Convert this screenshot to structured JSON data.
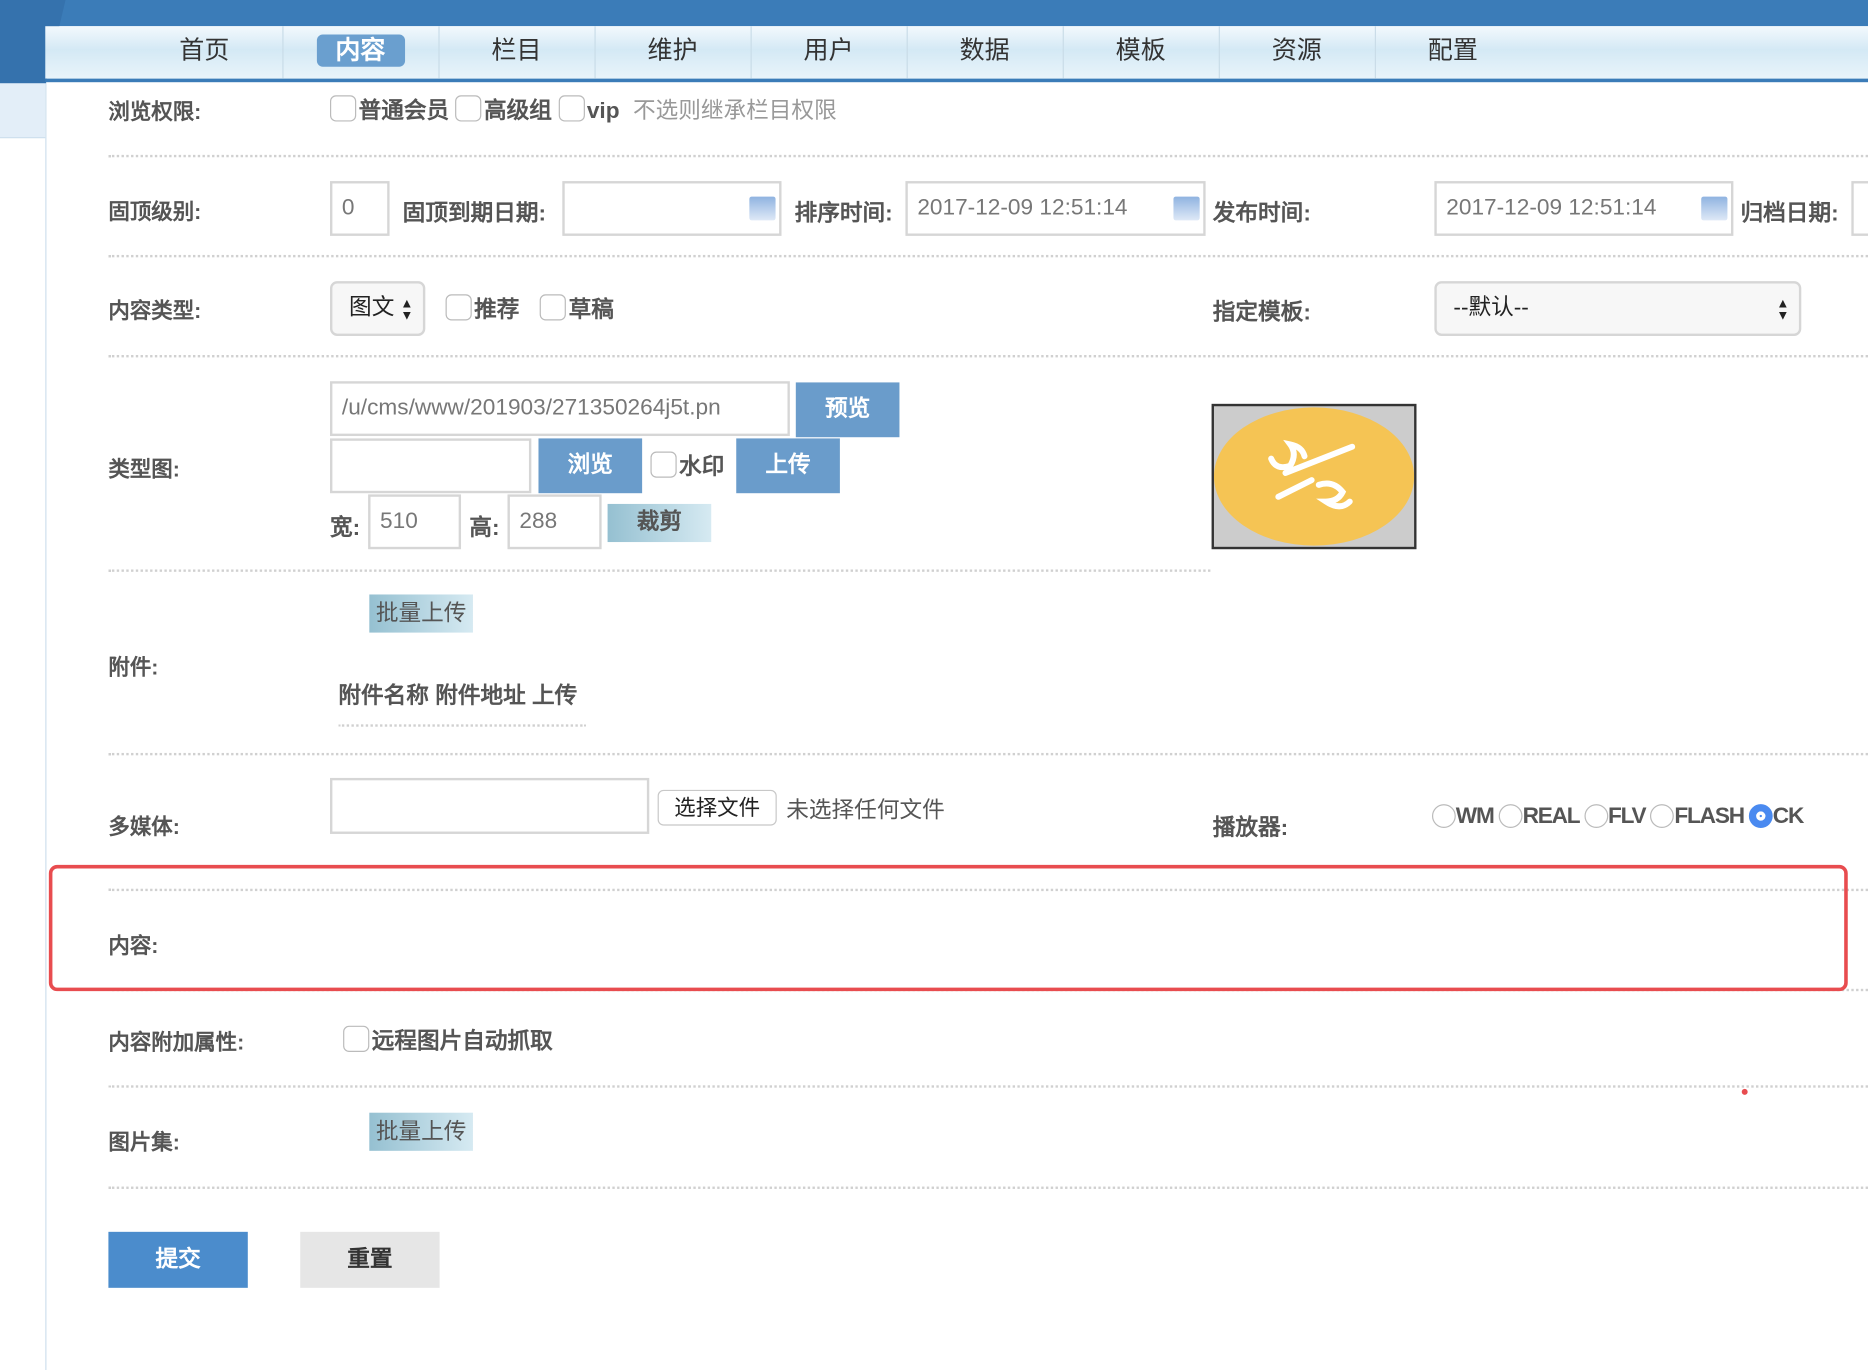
{
  "nav": {
    "items": [
      "首页",
      "内容",
      "栏目",
      "维护",
      "用户",
      "数据",
      "模板",
      "资源",
      "配置"
    ],
    "active": 1
  },
  "browse_permission": {
    "label": "浏览权限:",
    "options": [
      "普通会员",
      "高级组",
      "vip"
    ],
    "hint": "不选则继承栏目权限"
  },
  "top_level": {
    "label": "固顶级别:",
    "value": "0",
    "expire_label": "固顶到期日期:",
    "expire_value": "",
    "sort_label": "排序时间:",
    "sort_value": "2017-12-09 12:51:14",
    "publish_label": "发布时间:",
    "publish_value": "2017-12-09 12:51:14",
    "archive_label": "归档日期:"
  },
  "content_type": {
    "label": "内容类型:",
    "selected": "图文",
    "recommend": "推荐",
    "draft": "草稿",
    "template_label": "指定模板:",
    "template_selected": "--默认--"
  },
  "type_image": {
    "label": "类型图:",
    "path": "/u/cms/www/201903/271350264j5t.pn",
    "preview": "预览",
    "browse": "浏览",
    "watermark": "水印",
    "upload": "上传",
    "width_label": "宽:",
    "width": "510",
    "height_label": "高:",
    "height": "288",
    "crop": "裁剪",
    "thumb_bg": "#f5c454"
  },
  "attachment": {
    "label": "附件:",
    "batch_upload": "批量上传",
    "columns": [
      "附件名称",
      "附件地址",
      "上传"
    ]
  },
  "media": {
    "label": "多媒体:",
    "choose_file": "选择文件",
    "no_file": "未选择任何文件",
    "player_label": "播放器:",
    "players": [
      "WM",
      "REAL",
      "FLV",
      "FLASH",
      "CK"
    ],
    "player_selected": "CK"
  },
  "content": {
    "label": "内容:",
    "highlight_color": "#e84c4f"
  },
  "extra": {
    "label": "内容附加属性:",
    "remote_fetch": "远程图片自动抓取"
  },
  "gallery": {
    "label": "图片集:",
    "batch_upload": "批量上传"
  },
  "actions": {
    "submit": "提交",
    "reset": "重置"
  }
}
